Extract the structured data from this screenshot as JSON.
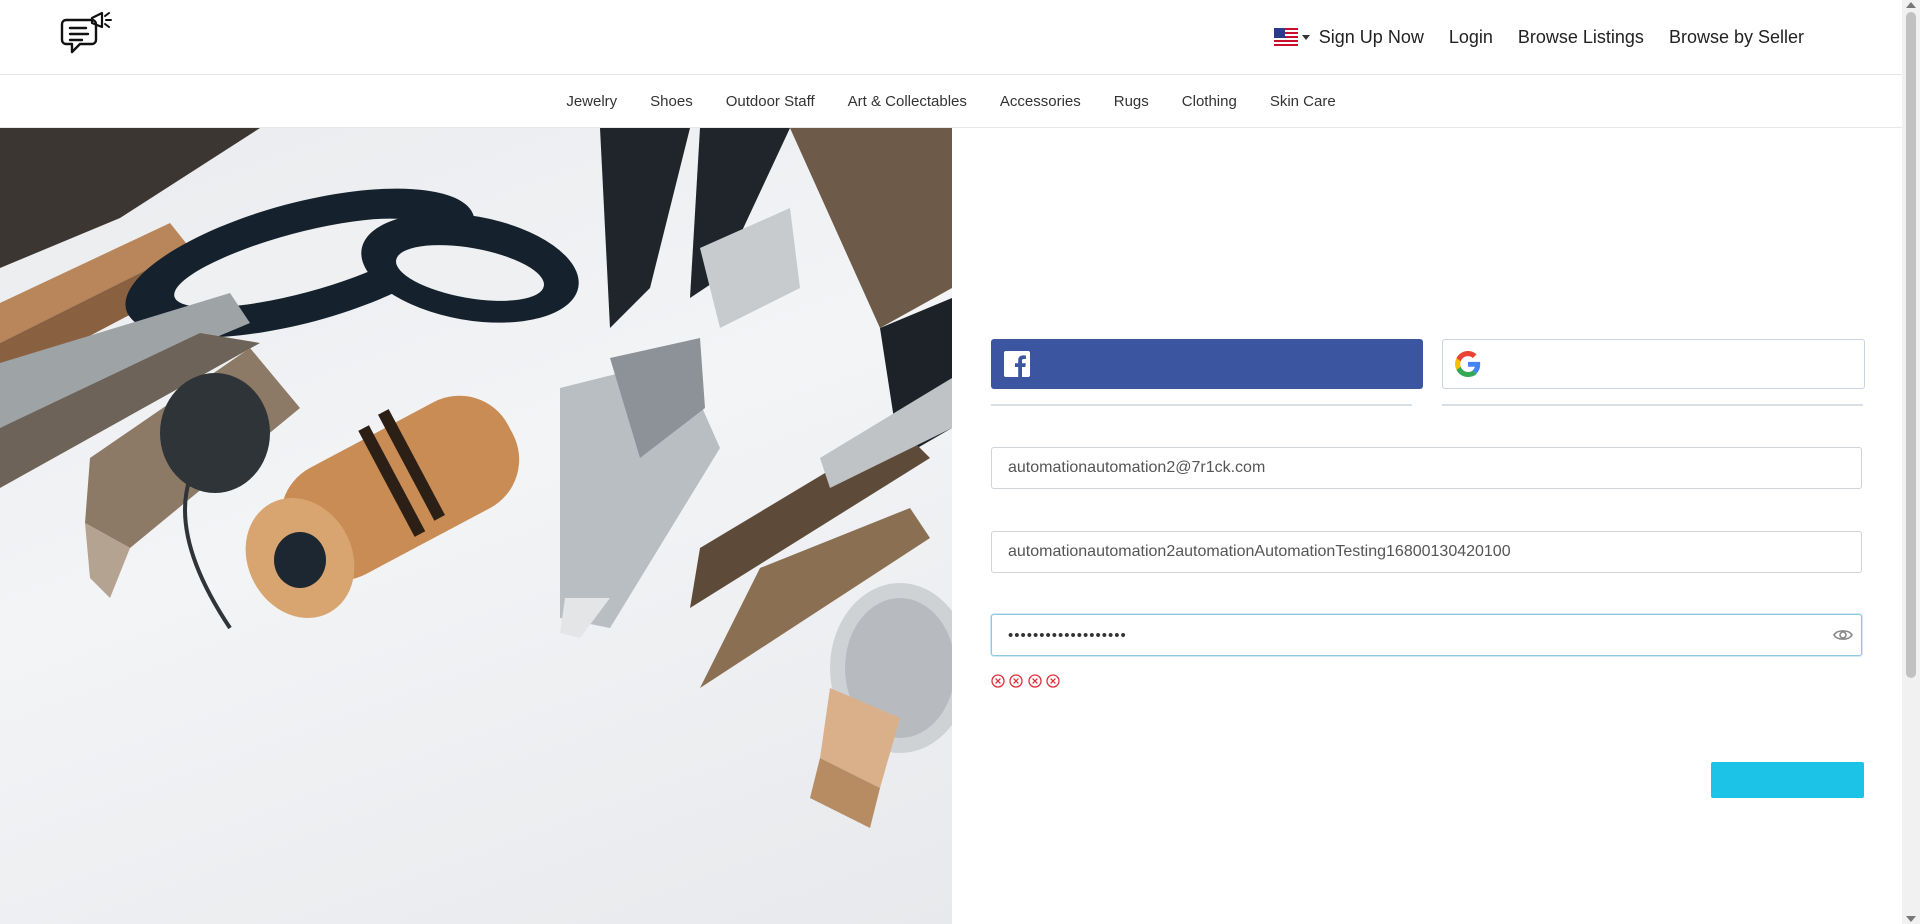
{
  "header": {
    "logo_icon": "chat-megaphone-logo-icon",
    "language_flag_icon": "us-flag-icon",
    "nav": {
      "sign_up": "Sign Up Now",
      "login": "Login",
      "browse_listings": "Browse Listings",
      "browse_by_seller": "Browse by Seller"
    }
  },
  "categories": [
    "Jewelry",
    "Shoes",
    "Outdoor Staff",
    "Art & Collectables",
    "Accessories",
    "Rugs",
    "Clothing",
    "Skin Care"
  ],
  "hero": {
    "image_icon": "craft-tools-photo"
  },
  "form": {
    "facebook_icon": "facebook-icon",
    "google_icon": "google-icon",
    "email_value": "automationautomation2@7r1ck.com",
    "username_value": "automationautomation2automationAutomationTesting16800130420100",
    "password_masked": "•••••••••••••••••••",
    "password_toggle_icon": "eye-icon",
    "rule_status_icon": "x-circle-icon",
    "rule_count": 4
  },
  "colors": {
    "facebook": "#3b55a0",
    "submit": "#1cc3e7",
    "error": "#e0303a",
    "focus_border": "#8ec9e2"
  }
}
